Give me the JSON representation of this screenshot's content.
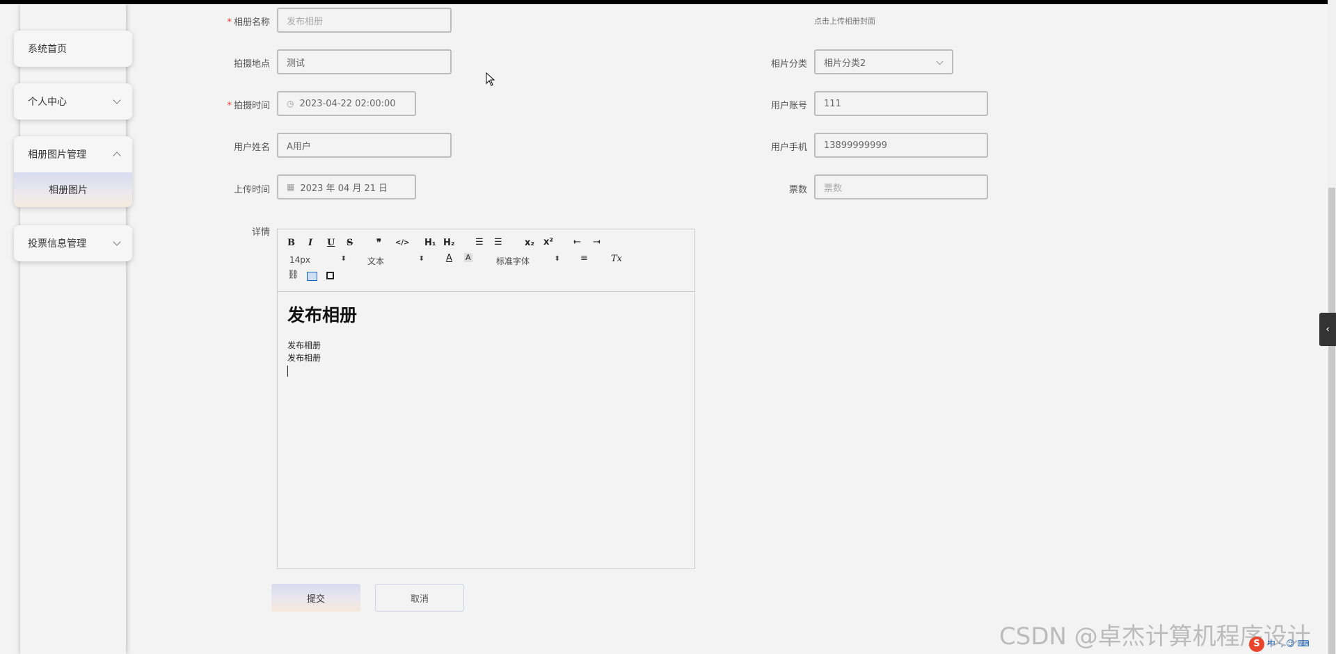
{
  "sidebar": {
    "items": [
      {
        "label": "系统首页"
      },
      {
        "label": "个人中心"
      },
      {
        "label": "相册图片管理",
        "children": [
          {
            "label": "相册图片"
          }
        ]
      },
      {
        "label": "投票信息管理"
      }
    ]
  },
  "form": {
    "album_name": {
      "label": "相册名称",
      "placeholder": "发布相册"
    },
    "cover_upload_text": "点击上传相册封面",
    "location": {
      "label": "拍摄地点",
      "value": "测试"
    },
    "category": {
      "label": "相片分类",
      "value": "相片分类2"
    },
    "shoot_time": {
      "label": "拍摄时间",
      "value": "2023-04-22 02:00:00"
    },
    "user_account": {
      "label": "用户账号",
      "value": "111"
    },
    "user_name": {
      "label": "用户姓名",
      "value": "A用户"
    },
    "user_phone": {
      "label": "用户手机",
      "value": "13899999999"
    },
    "upload_time": {
      "label": "上传时间",
      "value": "2023 年 04 月 21 日"
    },
    "votes": {
      "label": "票数",
      "placeholder": "票数"
    },
    "details": {
      "label": "详情"
    }
  },
  "editor": {
    "toolbar": {
      "bold": "B",
      "italic": "I",
      "underline": "U",
      "strike": "S",
      "quote": "❞",
      "code": "</>",
      "h1": "H₁",
      "h2": "H₂",
      "ordered_list": "☰",
      "bullet_list": "☰",
      "subscript": "x₂",
      "superscript": "x²",
      "outdent": "⇤",
      "indent": "⇥",
      "size": "14px",
      "header": "文本",
      "font": "标准字体",
      "color": "A",
      "background": "A",
      "align": "≡",
      "clean": "Tx"
    },
    "content": {
      "heading": "发布相册",
      "lines": [
        "发布相册",
        "发布相册"
      ]
    }
  },
  "buttons": {
    "submit": "提交",
    "cancel": "取消"
  },
  "watermark": "CSDN @卓杰计算机程序设计"
}
